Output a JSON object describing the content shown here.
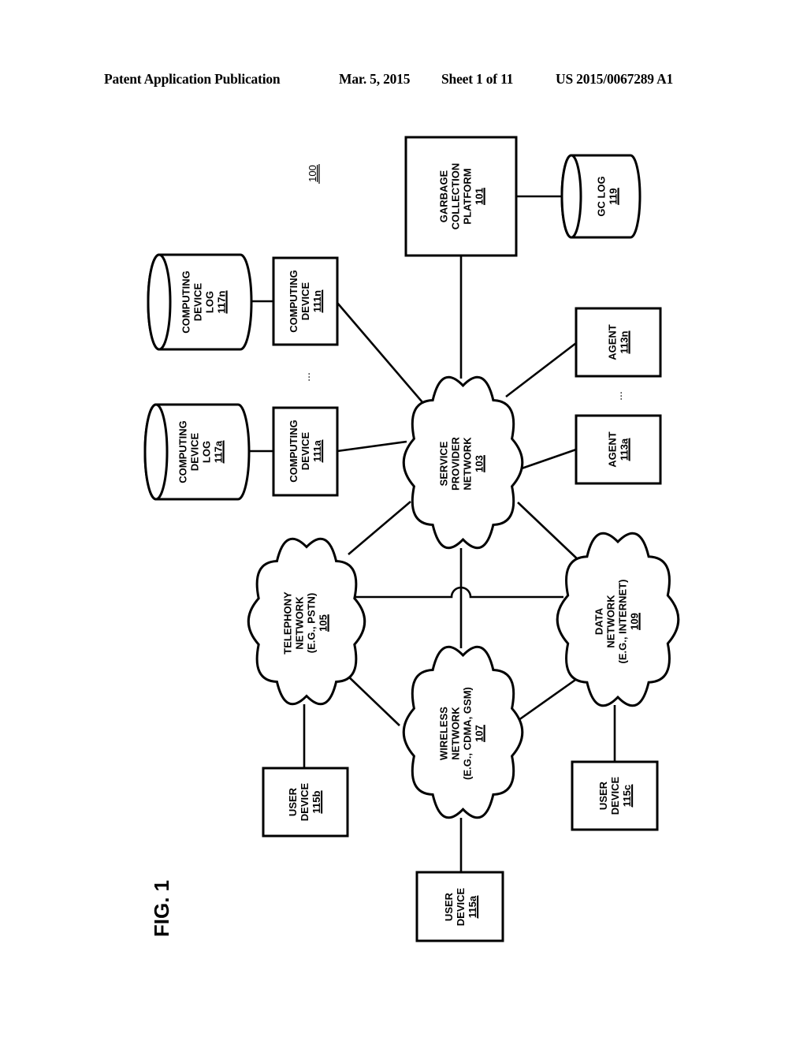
{
  "header": {
    "publication_type": "Patent Application Publication",
    "date": "Mar. 5, 2015",
    "sheet": "Sheet 1 of 11",
    "publication_number": "US 2015/0067289 A1"
  },
  "figure": {
    "label": "FIG. 1",
    "system_ref": "100",
    "ellipsis": "...",
    "nodes": {
      "gc_platform": {
        "lines": [
          "GARBAGE",
          "COLLECTION",
          "PLATFORM"
        ],
        "ref": "101",
        "shape": "box"
      },
      "gc_log": {
        "lines": [
          "GC LOG"
        ],
        "ref": "119",
        "shape": "database"
      },
      "service_provider": {
        "lines": [
          "SERVICE",
          "PROVIDER",
          "NETWORK"
        ],
        "ref": "103",
        "shape": "cloud"
      },
      "telephony": {
        "lines": [
          "TELEPHONY",
          "NETWORK",
          "(E.G., PSTN)"
        ],
        "ref": "105",
        "shape": "cloud"
      },
      "wireless": {
        "lines": [
          "WIRELESS",
          "NETWORK",
          "(E.G., CDMA, GSM)"
        ],
        "ref": "107",
        "shape": "cloud"
      },
      "data_net": {
        "lines": [
          "DATA",
          "NETWORK",
          "(E.G., INTERNET)"
        ],
        "ref": "109",
        "shape": "cloud"
      },
      "comp_dev_a": {
        "lines": [
          "COMPUTING",
          "DEVICE"
        ],
        "ref": "111a",
        "shape": "box"
      },
      "comp_dev_n": {
        "lines": [
          "COMPUTING",
          "DEVICE"
        ],
        "ref": "111n",
        "shape": "box"
      },
      "comp_log_a": {
        "lines": [
          "COMPUTING",
          "DEVICE",
          "LOG"
        ],
        "ref": "117a",
        "shape": "database"
      },
      "comp_log_n": {
        "lines": [
          "COMPUTING",
          "DEVICE",
          "LOG"
        ],
        "ref": "117n",
        "shape": "database"
      },
      "agent_a": {
        "lines": [
          "AGENT"
        ],
        "ref": "113a",
        "shape": "box"
      },
      "agent_n": {
        "lines": [
          "AGENT"
        ],
        "ref": "113n",
        "shape": "box"
      },
      "user_a": {
        "lines": [
          "USER",
          "DEVICE"
        ],
        "ref": "115a",
        "shape": "box"
      },
      "user_b": {
        "lines": [
          "USER",
          "DEVICE"
        ],
        "ref": "115b",
        "shape": "box"
      },
      "user_c": {
        "lines": [
          "USER",
          "DEVICE"
        ],
        "ref": "115c",
        "shape": "box"
      }
    },
    "edges": [
      [
        "gc_platform",
        "gc_log"
      ],
      [
        "gc_platform",
        "service_provider"
      ],
      [
        "comp_log_a",
        "comp_dev_a"
      ],
      [
        "comp_log_n",
        "comp_dev_n"
      ],
      [
        "comp_dev_a",
        "service_provider"
      ],
      [
        "comp_dev_n",
        "service_provider"
      ],
      [
        "agent_a",
        "service_provider"
      ],
      [
        "agent_n",
        "service_provider"
      ],
      [
        "service_provider",
        "telephony"
      ],
      [
        "service_provider",
        "wireless"
      ],
      [
        "service_provider",
        "data_net"
      ],
      [
        "telephony",
        "data_net"
      ],
      [
        "telephony",
        "wireless"
      ],
      [
        "data_net",
        "wireless"
      ],
      [
        "telephony",
        "user_b"
      ],
      [
        "wireless",
        "user_a"
      ],
      [
        "data_net",
        "user_c"
      ]
    ]
  }
}
